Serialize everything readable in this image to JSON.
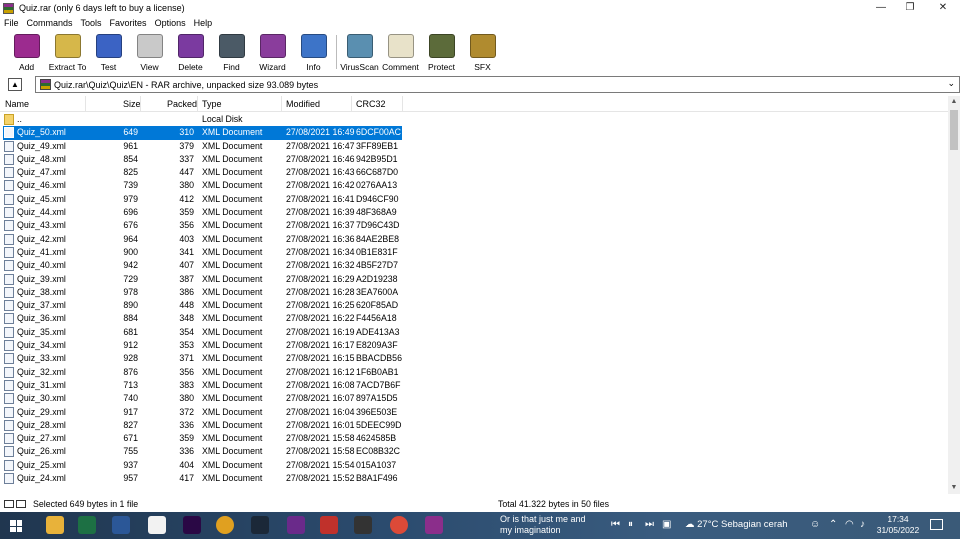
{
  "window": {
    "title": "Quiz.rar (only 6 days left to buy a license)",
    "controls": [
      "—",
      "❐",
      "✕"
    ]
  },
  "menu": [
    "File",
    "Commands",
    "Tools",
    "Favorites",
    "Options",
    "Help"
  ],
  "toolbar": [
    {
      "label": "Add",
      "icon": "add-icon",
      "color": "#9c2b8f"
    },
    {
      "label": "Extract To",
      "icon": "extract-icon",
      "color": "#d6b74a"
    },
    {
      "label": "Test",
      "icon": "test-icon",
      "color": "#3b63c4"
    },
    {
      "label": "View",
      "icon": "view-icon",
      "color": "#c9c9c9"
    },
    {
      "label": "Delete",
      "icon": "delete-icon",
      "color": "#7b3aa0"
    },
    {
      "label": "Find",
      "icon": "find-icon",
      "color": "#4b5a66"
    },
    {
      "label": "Wizard",
      "icon": "wizard-icon",
      "color": "#8a3d9c"
    },
    {
      "label": "Info",
      "icon": "info-icon",
      "color": "#3d74c8"
    },
    {
      "label": "VirusScan",
      "icon": "virusscan-icon",
      "color": "#5a8fb0"
    },
    {
      "label": "Comment",
      "icon": "comment-icon",
      "color": "#e8e2c9"
    },
    {
      "label": "Protect",
      "icon": "protect-icon",
      "color": "#5c6b3a"
    },
    {
      "label": "SFX",
      "icon": "sfx-icon",
      "color": "#b08b2f"
    }
  ],
  "address": {
    "up": "▲",
    "path": "Quiz.rar\\Quiz\\Quiz\\EN - RAR archive, unpacked size 93.089 bytes",
    "dropdown": "⌄"
  },
  "columns": {
    "name": "Name",
    "size": "Size",
    "packed": "Packed",
    "type": "Type",
    "modified": "Modified",
    "crc": "CRC32"
  },
  "files": [
    {
      "name": "..",
      "size": "",
      "packed": "",
      "type": "Local Disk",
      "modified": "",
      "crc": "",
      "folder": true
    },
    {
      "name": "Quiz_50.xml",
      "size": "649",
      "packed": "310",
      "type": "XML Document",
      "modified": "27/08/2021 16:49",
      "crc": "6DCF00AC",
      "selected": true
    },
    {
      "name": "Quiz_49.xml",
      "size": "961",
      "packed": "379",
      "type": "XML Document",
      "modified": "27/08/2021 16:47",
      "crc": "3FF89EB1"
    },
    {
      "name": "Quiz_48.xml",
      "size": "854",
      "packed": "337",
      "type": "XML Document",
      "modified": "27/08/2021 16:46",
      "crc": "942B95D1"
    },
    {
      "name": "Quiz_47.xml",
      "size": "825",
      "packed": "447",
      "type": "XML Document",
      "modified": "27/08/2021 16:43",
      "crc": "66C687D0"
    },
    {
      "name": "Quiz_46.xml",
      "size": "739",
      "packed": "380",
      "type": "XML Document",
      "modified": "27/08/2021 16:42",
      "crc": "0276AA13"
    },
    {
      "name": "Quiz_45.xml",
      "size": "979",
      "packed": "412",
      "type": "XML Document",
      "modified": "27/08/2021 16:41",
      "crc": "D946CF90"
    },
    {
      "name": "Quiz_44.xml",
      "size": "696",
      "packed": "359",
      "type": "XML Document",
      "modified": "27/08/2021 16:39",
      "crc": "48F368A9"
    },
    {
      "name": "Quiz_43.xml",
      "size": "676",
      "packed": "356",
      "type": "XML Document",
      "modified": "27/08/2021 16:37",
      "crc": "7D96C43D"
    },
    {
      "name": "Quiz_42.xml",
      "size": "964",
      "packed": "403",
      "type": "XML Document",
      "modified": "27/08/2021 16:36",
      "crc": "84AE2BE8"
    },
    {
      "name": "Quiz_41.xml",
      "size": "900",
      "packed": "341",
      "type": "XML Document",
      "modified": "27/08/2021 16:34",
      "crc": "0B1E831F"
    },
    {
      "name": "Quiz_40.xml",
      "size": "942",
      "packed": "407",
      "type": "XML Document",
      "modified": "27/08/2021 16:32",
      "crc": "4B5F27D7"
    },
    {
      "name": "Quiz_39.xml",
      "size": "729",
      "packed": "387",
      "type": "XML Document",
      "modified": "27/08/2021 16:29",
      "crc": "A2D19238"
    },
    {
      "name": "Quiz_38.xml",
      "size": "978",
      "packed": "386",
      "type": "XML Document",
      "modified": "27/08/2021 16:28",
      "crc": "3EA7600A"
    },
    {
      "name": "Quiz_37.xml",
      "size": "890",
      "packed": "448",
      "type": "XML Document",
      "modified": "27/08/2021 16:25",
      "crc": "620F85AD"
    },
    {
      "name": "Quiz_36.xml",
      "size": "884",
      "packed": "348",
      "type": "XML Document",
      "modified": "27/08/2021 16:22",
      "crc": "F4456A18"
    },
    {
      "name": "Quiz_35.xml",
      "size": "681",
      "packed": "354",
      "type": "XML Document",
      "modified": "27/08/2021 16:19",
      "crc": "ADE413A3"
    },
    {
      "name": "Quiz_34.xml",
      "size": "912",
      "packed": "353",
      "type": "XML Document",
      "modified": "27/08/2021 16:17",
      "crc": "E8209A3F"
    },
    {
      "name": "Quiz_33.xml",
      "size": "928",
      "packed": "371",
      "type": "XML Document",
      "modified": "27/08/2021 16:15",
      "crc": "BBACDB56"
    },
    {
      "name": "Quiz_32.xml",
      "size": "876",
      "packed": "356",
      "type": "XML Document",
      "modified": "27/08/2021 16:12",
      "crc": "1F6B0AB1"
    },
    {
      "name": "Quiz_31.xml",
      "size": "713",
      "packed": "383",
      "type": "XML Document",
      "modified": "27/08/2021 16:08",
      "crc": "7ACD7B6F"
    },
    {
      "name": "Quiz_30.xml",
      "size": "740",
      "packed": "380",
      "type": "XML Document",
      "modified": "27/08/2021 16:07",
      "crc": "897A15D5"
    },
    {
      "name": "Quiz_29.xml",
      "size": "917",
      "packed": "372",
      "type": "XML Document",
      "modified": "27/08/2021 16:04",
      "crc": "396E503E"
    },
    {
      "name": "Quiz_28.xml",
      "size": "827",
      "packed": "336",
      "type": "XML Document",
      "modified": "27/08/2021 16:01",
      "crc": "5DEEC99D"
    },
    {
      "name": "Quiz_27.xml",
      "size": "671",
      "packed": "359",
      "type": "XML Document",
      "modified": "27/08/2021 15:58",
      "crc": "4624585B"
    },
    {
      "name": "Quiz_26.xml",
      "size": "755",
      "size2": "",
      "packed": "336",
      "type": "XML Document",
      "modified": "27/08/2021 15:58",
      "crc": "EC08B32C"
    },
    {
      "name": "Quiz_25.xml",
      "size": "937",
      "packed": "404",
      "type": "XML Document",
      "modified": "27/08/2021 15:54",
      "crc": "015A1037"
    },
    {
      "name": "Quiz_24.xml",
      "size": "957",
      "packed": "417",
      "type": "XML Document",
      "modified": "27/08/2021 15:52",
      "crc": "B8A1F496"
    }
  ],
  "status": {
    "left": "Selected 649 bytes in 1 file",
    "right": "Total 41.322 bytes in 50 files"
  },
  "taskbar": {
    "apps": [
      {
        "name": "explorer-icon",
        "color": "#e8b23a"
      },
      {
        "name": "excel-icon",
        "color": "#1d7044"
      },
      {
        "name": "word-icon",
        "color": "#2b5797"
      },
      {
        "name": "notes-icon",
        "color": "#f2f2f2"
      },
      {
        "name": "premiere-icon",
        "color": "#2a0845"
      },
      {
        "name": "chrome-icon",
        "color": "#e0a020"
      },
      {
        "name": "steam-icon",
        "color": "#1b2838"
      },
      {
        "name": "game-icon",
        "color": "#6a2a8a"
      },
      {
        "name": "flash-icon",
        "color": "#c0312b"
      },
      {
        "name": "obs-icon",
        "color": "#333333"
      },
      {
        "name": "chrome2-icon",
        "color": "#dc4a38"
      },
      {
        "name": "winrar-icon",
        "color": "#8b2e8b"
      }
    ],
    "media_line1": "Or is that just me and",
    "media_line2": "my imagination",
    "weather": "27°C  Sebagian cerah",
    "time": "17:34",
    "date": "31/05/2022"
  }
}
